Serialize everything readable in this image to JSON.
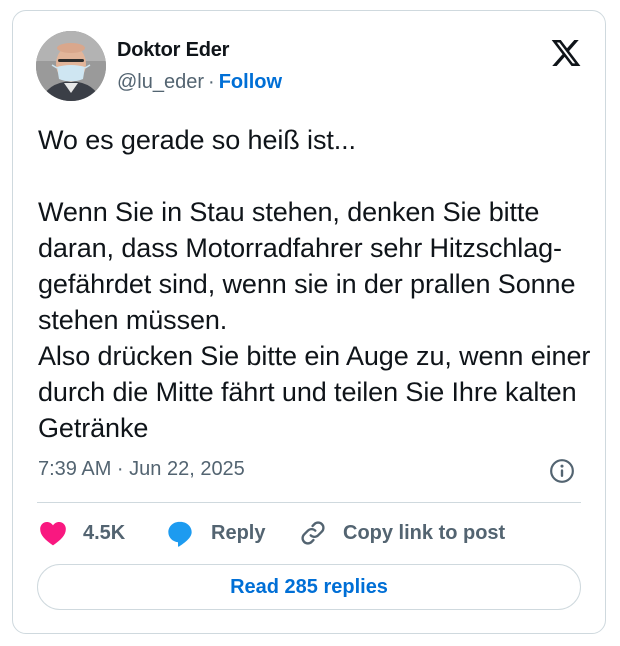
{
  "author": {
    "name": "Doktor Eder",
    "handle": "@lu_eder",
    "separator": "·",
    "follow_label": "Follow"
  },
  "platform_icon": "x-logo-icon",
  "tweet": {
    "text": "Wo es gerade so heiß ist...\n\nWenn Sie in Stau stehen, denken Sie bitte daran, dass Motorradfahrer sehr Hitzschlag- gefährdet sind, wenn sie in der prallen Sonne stehen müssen.\nAlso drücken Sie bitte ein Auge zu, wenn einer durch die Mitte fährt und teilen Sie Ihre kalten Getränke",
    "timestamp": "7:39 AM · Jun 22, 2025"
  },
  "actions": {
    "like_count": "4.5K",
    "reply_label": "Reply",
    "copy_label": "Copy link to post"
  },
  "read_replies_label": "Read 285 replies",
  "colors": {
    "like": "#f91880",
    "reply": "#1d9bf0",
    "link": "#006fd6",
    "muted": "#536471",
    "border": "#cfd9de"
  }
}
